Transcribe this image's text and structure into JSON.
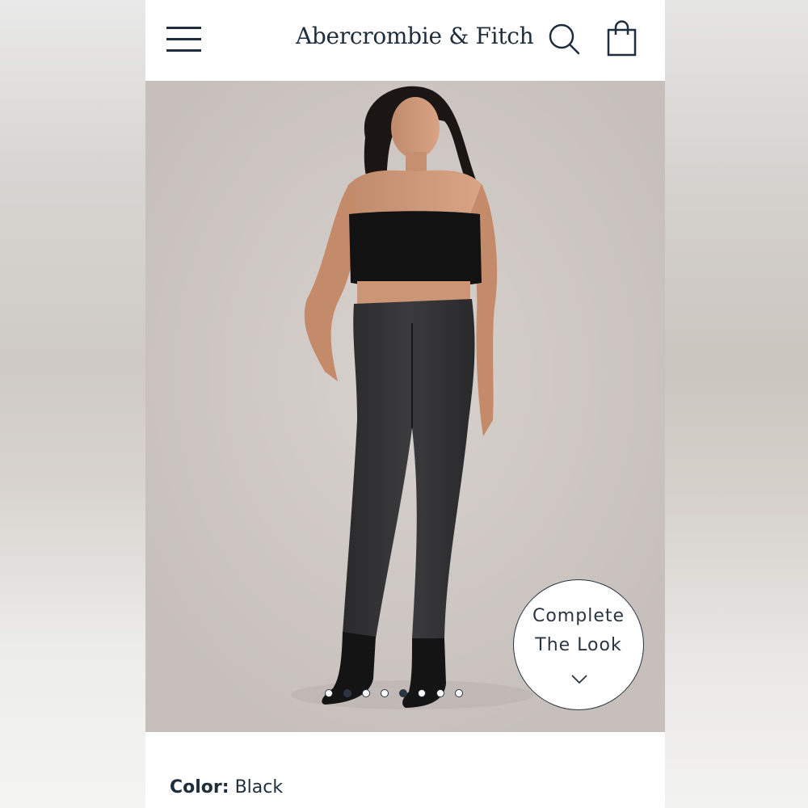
{
  "header": {
    "brand": "Abercrombie & Fitch",
    "menu_icon": "hamburger-menu-icon",
    "search_icon": "search-icon",
    "bag_icon": "shopping-bag-icon"
  },
  "carousel": {
    "image_count": 8,
    "active_index": 1,
    "secondary_index": 4
  },
  "complete_the_look": {
    "line1": "Complete",
    "line2": "The Look",
    "icon": "chevron-down-icon"
  },
  "product": {
    "color_label": "Color:",
    "color_value": "Black"
  },
  "colors": {
    "brand_navy": "#1f2e3d",
    "hero_bg": "#cfc8c4"
  }
}
